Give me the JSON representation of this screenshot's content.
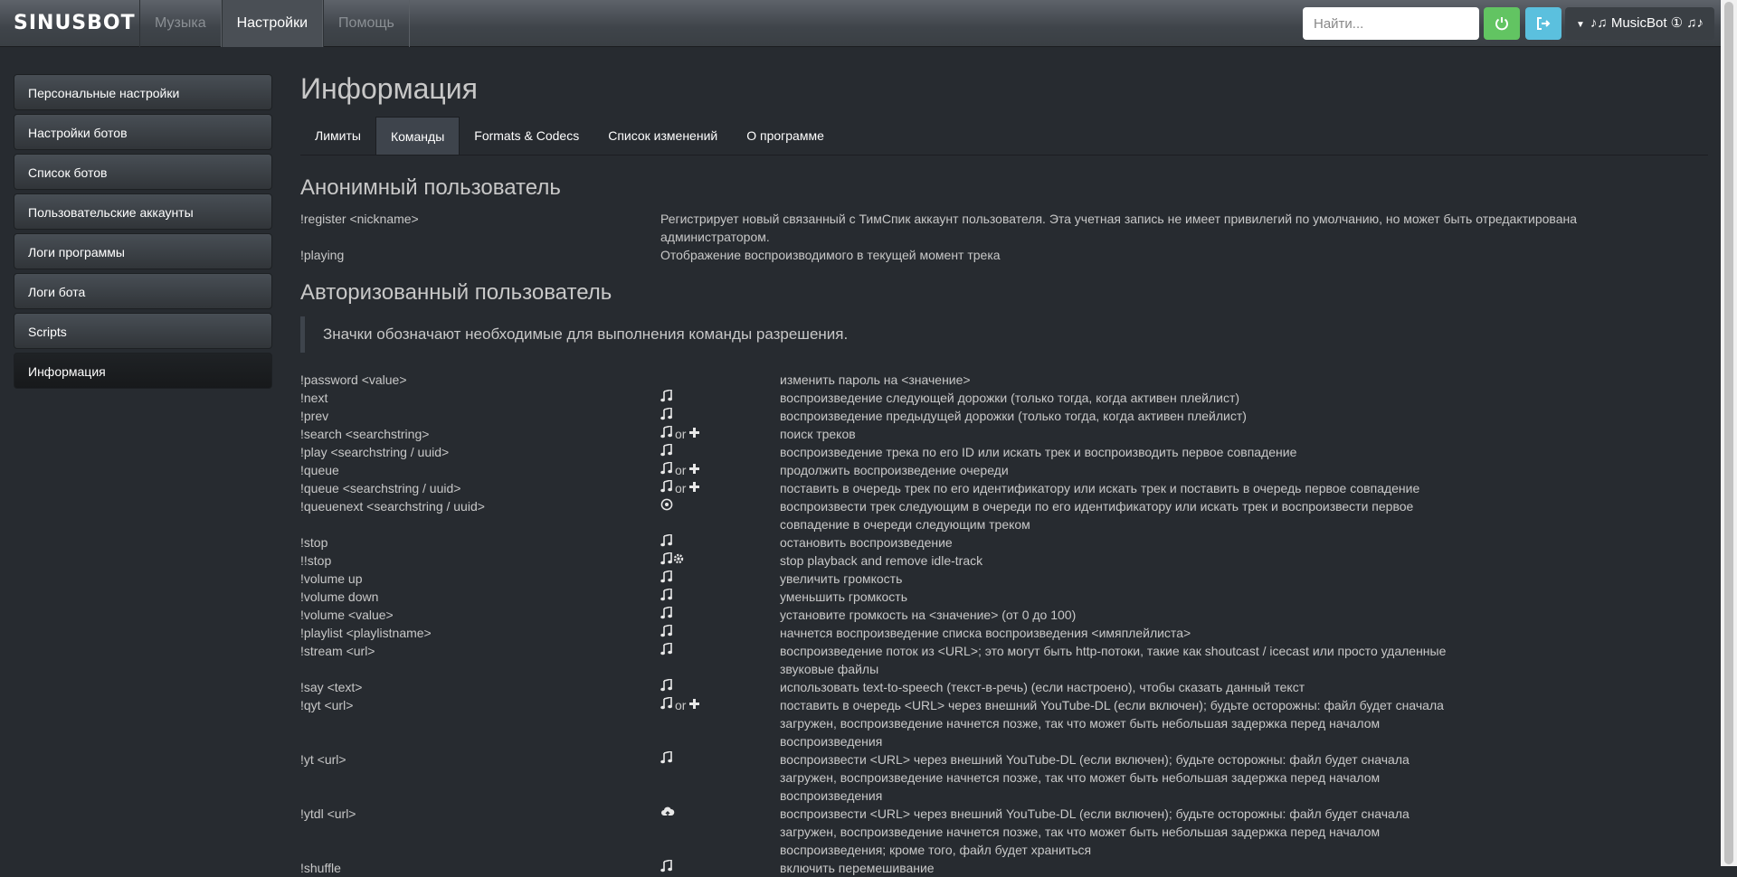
{
  "brand": "SINUSBOT",
  "top_nav": [
    "Музыка",
    "Настройки",
    "Помощь"
  ],
  "search_placeholder": "Найти...",
  "bot_selector": "♪♫ MusicBot ① ♫♪",
  "sidebar": [
    "Персональные настройки",
    "Настройки ботов",
    "Список ботов",
    "Пользовательские аккаунты",
    "Логи программы",
    "Логи бота",
    "Scripts",
    "Информация"
  ],
  "page_title": "Информация",
  "tabs": [
    "Лимиты",
    "Команды",
    "Formats & Codecs",
    "Список изменений",
    "О программе"
  ],
  "anon_title": "Анонимный пользователь",
  "anon_commands": [
    {
      "cmd": "!register <nickname>",
      "desc": "Регистрирует новый связанный с ТимСпик аккаунт пользователя. Эта учетная запись не имеет привилегий по умолчанию, но может быть отредактирована администратором."
    },
    {
      "cmd": "!playing",
      "desc": "Отображение воспроизводимого в текущей момент трека"
    }
  ],
  "auth_title": "Авторизованный пользователь",
  "permissions_note": "Значки обозначают необходимые для выполнения команды разрешения.",
  "or_text": "or",
  "auth_commands": [
    {
      "cmd": "!password <value>",
      "perm": [],
      "desc": "изменить пароль на <значение>"
    },
    {
      "cmd": "!next",
      "perm": [
        "music-note-icon"
      ],
      "desc": "воспроизведение следующей дорожки (только тогда, когда активен плейлист)"
    },
    {
      "cmd": "!prev",
      "perm": [
        "music-note-icon"
      ],
      "desc": "воспроизведение предыдущей дорожки (только тогда, когда активен плейлист)"
    },
    {
      "cmd": "!search <searchstring>",
      "perm": [
        "music-note-icon",
        "or",
        "plus-icon"
      ],
      "desc": "поиск треков"
    },
    {
      "cmd": "!play <searchstring / uuid>",
      "perm": [
        "music-note-icon"
      ],
      "desc": "воспроизведение трека по его ID или искать трек и воспроизводить первое совпадение"
    },
    {
      "cmd": "!queue",
      "perm": [
        "music-note-icon",
        "or",
        "plus-icon"
      ],
      "desc": "продолжить воспроизведение очереди"
    },
    {
      "cmd": "!queue <searchstring / uuid>",
      "perm": [
        "music-note-icon",
        "or",
        "plus-icon"
      ],
      "desc": "поставить в очередь трек по его идентификатору или искать трек и поставить в очередь первое совпадение"
    },
    {
      "cmd": "!queuenext <searchstring / uuid>",
      "perm": [
        "circle-play-icon"
      ],
      "desc": "воспроизвести трек следующим в очереди по его идентификатору или искать трек и воспроизвести первое совпадение в очереди следующим треком"
    },
    {
      "cmd": "!stop",
      "perm": [
        "music-note-icon"
      ],
      "desc": "остановить воспроизведение"
    },
    {
      "cmd": "!!stop",
      "perm": [
        "music-note-icon",
        "gear-icon"
      ],
      "desc": "stop playback and remove idle-track"
    },
    {
      "cmd": "!volume up",
      "perm": [
        "music-note-icon"
      ],
      "desc": "увеличить громкость"
    },
    {
      "cmd": "!volume down",
      "perm": [
        "music-note-icon"
      ],
      "desc": "уменьшить громкость"
    },
    {
      "cmd": "!volume <value>",
      "perm": [
        "music-note-icon"
      ],
      "desc": "установите громкость на <значение> (от 0 до 100)"
    },
    {
      "cmd": "!playlist <playlistname>",
      "perm": [
        "music-note-icon"
      ],
      "desc": "начнется воспроизведение списка воспроизведения <имяплейлиста>"
    },
    {
      "cmd": "!stream <url>",
      "perm": [
        "music-note-icon"
      ],
      "desc": "воспроизведение поток из <URL>; это могут быть http-потоки, такие как shoutcast / icecast или просто удаленные звуковые файлы"
    },
    {
      "cmd": "!say <text>",
      "perm": [
        "music-note-icon"
      ],
      "desc": "использовать text-to-speech (текст-в-речь) (если настроено), чтобы сказать данный текст"
    },
    {
      "cmd": "!qyt <url>",
      "perm": [
        "music-note-icon",
        "or",
        "plus-icon"
      ],
      "desc": "поставить в очередь <URL> через внешний YouTube-DL (если включен); будьте осторожны: файл будет сначала загружен, воспроизведение начнется позже, так что может быть небольшая задержка перед началом воспроизведения"
    },
    {
      "cmd": "!yt <url>",
      "perm": [
        "music-note-icon"
      ],
      "desc": "воспроизвести <URL> через внешний YouTube-DL (если включен); будьте осторожны: файл будет сначала загружен, воспроизведение начнется позже, так что может быть небольшая задержка перед началом воспроизведения"
    },
    {
      "cmd": "!ytdl <url>",
      "perm": [
        "cloud-upload-icon"
      ],
      "desc": "воспроизвести <URL> через внешний YouTube-DL (если включен); будьте осторожны: файл будет сначала загружен, воспроизведение начнется позже, так что может быть небольшая задержка перед началом воспроизведения; кроме того, файл будет храниться"
    },
    {
      "cmd": "!shuffle",
      "perm": [
        "music-note-icon"
      ],
      "desc": "включить перемешивание"
    }
  ]
}
